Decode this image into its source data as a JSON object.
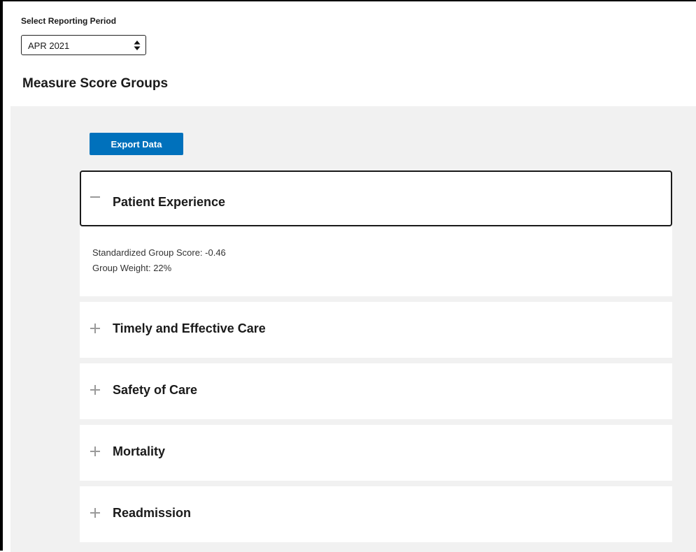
{
  "reporting_period": {
    "label": "Select Reporting Period",
    "selected": "APR 2021"
  },
  "section_title": "Measure Score Groups",
  "export_button_label": "Export Data",
  "groups": [
    {
      "title": "Patient Experience",
      "expanded": true,
      "icon": "minus-icon",
      "details": {
        "score_line": "Standardized Group Score: -0.46",
        "weight_line": "Group Weight: 22%"
      }
    },
    {
      "title": "Timely and Effective Care",
      "expanded": false,
      "icon": "plus-icon"
    },
    {
      "title": "Safety of Care",
      "expanded": false,
      "icon": "plus-icon"
    },
    {
      "title": "Mortality",
      "expanded": false,
      "icon": "plus-icon"
    },
    {
      "title": "Readmission",
      "expanded": false,
      "icon": "plus-icon"
    }
  ],
  "colors": {
    "accent": "#0071bc",
    "panel_background": "#f1f1f1",
    "icon_gray": "#9a9a9a"
  }
}
